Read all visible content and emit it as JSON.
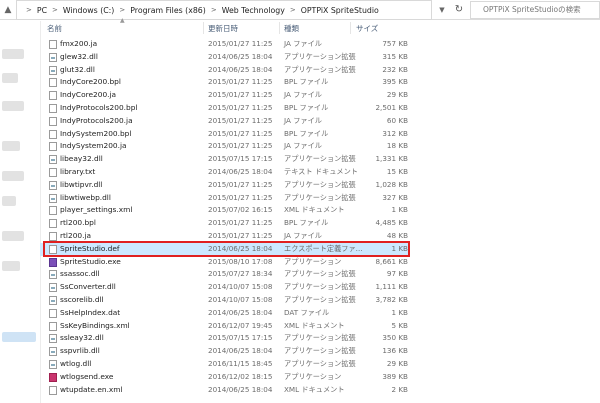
{
  "address": {
    "segments": [
      "PC",
      "Windows (C:)",
      "Program Files (x86)",
      "Web Technology",
      "OPTPiX SpriteStudio"
    ],
    "search_placeholder": "OPTPiX SpriteStudioの検索"
  },
  "columns": {
    "name": "名前",
    "date": "更新日時",
    "type": "種類",
    "size": "サイズ"
  },
  "files": [
    {
      "name": "fmx200.ja",
      "date": "2015/01/27 11:25",
      "type": "JA ファイル",
      "size": "757 KB",
      "icon": "file-icon"
    },
    {
      "name": "glew32.dll",
      "date": "2014/06/25 18:04",
      "type": "アプリケーション拡張",
      "size": "315 KB",
      "icon": "dll-icon"
    },
    {
      "name": "glut32.dll",
      "date": "2014/06/25 18:04",
      "type": "アプリケーション拡張",
      "size": "232 KB",
      "icon": "dll-icon"
    },
    {
      "name": "IndyCore200.bpl",
      "date": "2015/01/27 11:25",
      "type": "BPL ファイル",
      "size": "395 KB",
      "icon": "file-icon"
    },
    {
      "name": "IndyCore200.ja",
      "date": "2015/01/27 11:25",
      "type": "JA ファイル",
      "size": "29 KB",
      "icon": "file-icon"
    },
    {
      "name": "IndyProtocols200.bpl",
      "date": "2015/01/27 11:25",
      "type": "BPL ファイル",
      "size": "2,501 KB",
      "icon": "file-icon"
    },
    {
      "name": "IndyProtocols200.ja",
      "date": "2015/01/27 11:25",
      "type": "JA ファイル",
      "size": "60 KB",
      "icon": "file-icon"
    },
    {
      "name": "IndySystem200.bpl",
      "date": "2015/01/27 11:25",
      "type": "BPL ファイル",
      "size": "312 KB",
      "icon": "file-icon"
    },
    {
      "name": "IndySystem200.ja",
      "date": "2015/01/27 11:25",
      "type": "JA ファイル",
      "size": "18 KB",
      "icon": "file-icon"
    },
    {
      "name": "libeay32.dll",
      "date": "2015/07/15 17:15",
      "type": "アプリケーション拡張",
      "size": "1,331 KB",
      "icon": "dll-icon"
    },
    {
      "name": "library.txt",
      "date": "2014/06/25 18:04",
      "type": "テキスト ドキュメント",
      "size": "15 KB",
      "icon": "file-icon"
    },
    {
      "name": "libwtipvr.dll",
      "date": "2015/01/27 11:25",
      "type": "アプリケーション拡張",
      "size": "1,028 KB",
      "icon": "dll-icon"
    },
    {
      "name": "libwtiwebp.dll",
      "date": "2015/01/27 11:25",
      "type": "アプリケーション拡張",
      "size": "327 KB",
      "icon": "dll-icon"
    },
    {
      "name": "player_settings.xml",
      "date": "2015/07/02 16:15",
      "type": "XML ドキュメント",
      "size": "1 KB",
      "icon": "file-icon"
    },
    {
      "name": "rtl200.bpl",
      "date": "2015/01/27 11:25",
      "type": "BPL ファイル",
      "size": "4,485 KB",
      "icon": "file-icon"
    },
    {
      "name": "rtl200.ja",
      "date": "2015/01/27 11:25",
      "type": "JA ファイル",
      "size": "48 KB",
      "icon": "file-icon"
    },
    {
      "name": "SpriteStudio.def",
      "date": "2014/06/25 18:04",
      "type": "エクスポート定義ファ...",
      "size": "1 KB",
      "icon": "file-icon",
      "selected": true
    },
    {
      "name": "SpriteStudio.exe",
      "date": "2015/08/10 17:08",
      "type": "アプリケーション",
      "size": "8,661 KB",
      "icon": "exe-icon"
    },
    {
      "name": "ssassoc.dll",
      "date": "2015/07/27 18:34",
      "type": "アプリケーション拡張",
      "size": "97 KB",
      "icon": "dll-icon"
    },
    {
      "name": "SsConverter.dll",
      "date": "2014/10/07 15:08",
      "type": "アプリケーション拡張",
      "size": "1,111 KB",
      "icon": "dll-icon"
    },
    {
      "name": "sscorelib.dll",
      "date": "2014/10/07 15:08",
      "type": "アプリケーション拡張",
      "size": "3,782 KB",
      "icon": "dll-icon"
    },
    {
      "name": "SsHelpIndex.dat",
      "date": "2014/06/25 18:04",
      "type": "DAT ファイル",
      "size": "1 KB",
      "icon": "file-icon"
    },
    {
      "name": "SsKeyBindings.xml",
      "date": "2016/12/07 19:45",
      "type": "XML ドキュメント",
      "size": "5 KB",
      "icon": "file-icon"
    },
    {
      "name": "ssleay32.dll",
      "date": "2015/07/15 17:15",
      "type": "アプリケーション拡張",
      "size": "350 KB",
      "icon": "dll-icon"
    },
    {
      "name": "sspvrlib.dll",
      "date": "2014/06/25 18:04",
      "type": "アプリケーション拡張",
      "size": "136 KB",
      "icon": "dll-icon"
    },
    {
      "name": "wtlog.dll",
      "date": "2016/11/15 18:45",
      "type": "アプリケーション拡張",
      "size": "29 KB",
      "icon": "dll-icon"
    },
    {
      "name": "wtlogsend.exe",
      "date": "2016/12/02 18:15",
      "type": "アプリケーション",
      "size": "389 KB",
      "icon": "sprite-icon"
    },
    {
      "name": "wtupdate.en.xml",
      "date": "2014/06/25 18:04",
      "type": "XML ドキュメント",
      "size": "2 KB",
      "icon": "file-icon"
    }
  ]
}
